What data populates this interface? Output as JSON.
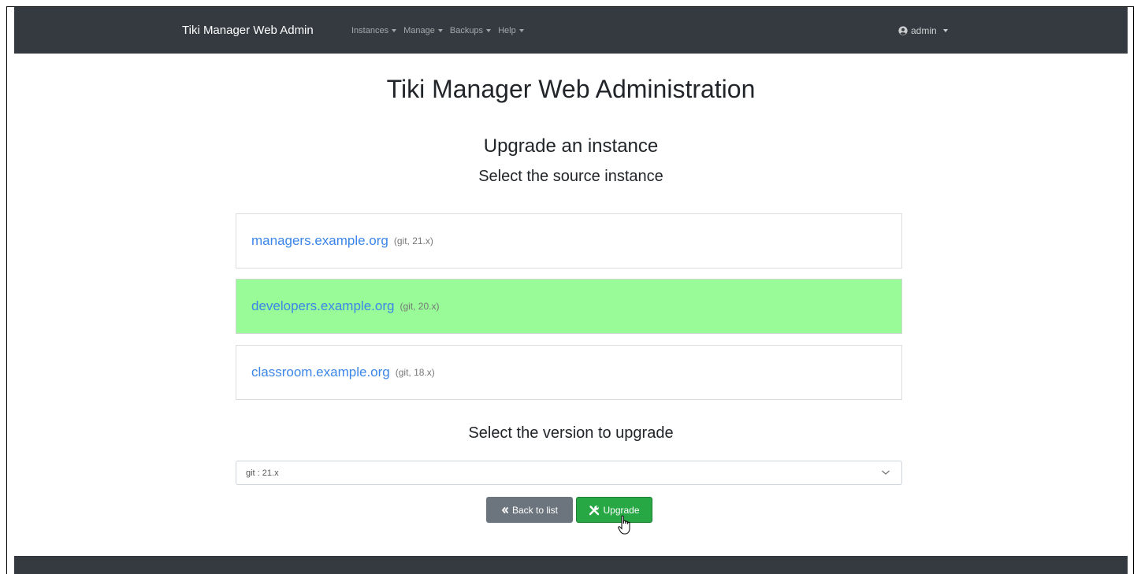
{
  "navbar": {
    "brand": "Tiki Manager Web Admin",
    "links": [
      "Instances",
      "Manage",
      "Backups",
      "Help"
    ],
    "user": "admin"
  },
  "main": {
    "title": "Tiki Manager Web Administration",
    "subtitle": "Upgrade an instance",
    "source_prompt": "Select the source instance",
    "instances": [
      {
        "name": "managers.example.org",
        "meta": "(git, 21.x)",
        "selected": false
      },
      {
        "name": "developers.example.org",
        "meta": "(git, 20.x)",
        "selected": true
      },
      {
        "name": "classroom.example.org",
        "meta": "(git, 18.x)",
        "selected": false
      }
    ],
    "version_prompt": "Select the version to upgrade",
    "version_select": {
      "selected": "git : 21.x"
    },
    "buttons": {
      "back": "Back to list",
      "upgrade": "Upgrade"
    }
  },
  "colors": {
    "navbar_bg": "#343a40",
    "selected_row": "#98fb98",
    "link": "#3b86e8",
    "upgrade_button": "#28a745",
    "back_button": "#6c757d"
  }
}
